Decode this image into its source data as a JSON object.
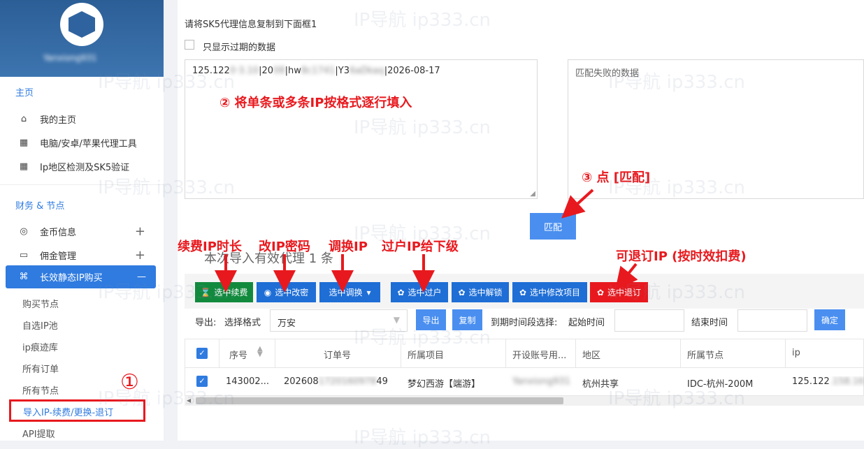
{
  "sidebar": {
    "user_name": "Yanxiong931",
    "group_home": "主页",
    "group_finance": "财务 & 节点",
    "items": [
      {
        "label": "我的主页"
      },
      {
        "label": "电脑/安卓/苹果代理工具"
      },
      {
        "label": "Ip地区检测及SK5验证"
      },
      {
        "label": "金币信息",
        "toggle": "+"
      },
      {
        "label": "佣金管理",
        "toggle": "+"
      }
    ],
    "active": {
      "label": "长效静态IP购买",
      "toggle": "—"
    },
    "subitems": [
      "购买节点",
      "自选IP池",
      "ip痕迹库",
      "所有订单",
      "所有节点"
    ],
    "highlighted_sub": "导入IP-续费/更换-退订",
    "last_sub": "API提取"
  },
  "main": {
    "instruction": "请将SK5代理信息复制到下面框1",
    "only_expired_label": "只显示过期的数据",
    "textarea_parts": [
      "125.122",
      "|20",
      "|hw",
      "|Y3",
      "|2026-08-17"
    ],
    "failed_placeholder": "匹配失败的数据",
    "match_button": "匹配",
    "import_summary": "本次导入有效代理 1 条"
  },
  "watermark": "IP导航  ip333.cn",
  "annotations": {
    "circle1": "①",
    "step2": "② 将单条或多条IP按格式逐行填入",
    "step3": "③ 点 [匹配]",
    "renew": "续费IP时长",
    "change_pwd": "改IP密码",
    "swap": "调换IP",
    "transfer": "过户IP给下级",
    "refund": "可退订IP (按时效扣费)"
  },
  "toolbar": {
    "renew": "选中续费",
    "change_pwd": "选中改密",
    "swap": "选中调换",
    "transfer": "选中过户",
    "unlock": "选中解锁",
    "modify_project": "选中修改项目",
    "refund": "选中退订"
  },
  "export_row": {
    "export_label": "导出:",
    "format_label": "选择格式",
    "format_value": "万安",
    "export_button": "导出",
    "copy_button": "复制",
    "date_range_label": "到期时间段选择:",
    "start_label": "起始时间",
    "end_label": "结束时间",
    "confirm_button": "确定"
  },
  "table": {
    "headers": [
      "序号",
      "订单号",
      "所属项目",
      "开设账号用...",
      "地区",
      "所属节点",
      "ip"
    ],
    "row": {
      "index": "143002...",
      "order_prefix": "202608",
      "order_suffix": "49",
      "project": "梦幻西游【端游】",
      "account": "Yanxiong931",
      "region": "杭州共享",
      "node": "IDC-杭州-200M",
      "ip": "125.122"
    }
  },
  "colors": {
    "primary": "#2f7be0",
    "annotation": "#e8191e",
    "green_button": "#128a3e",
    "red_button": "#e8191e"
  }
}
